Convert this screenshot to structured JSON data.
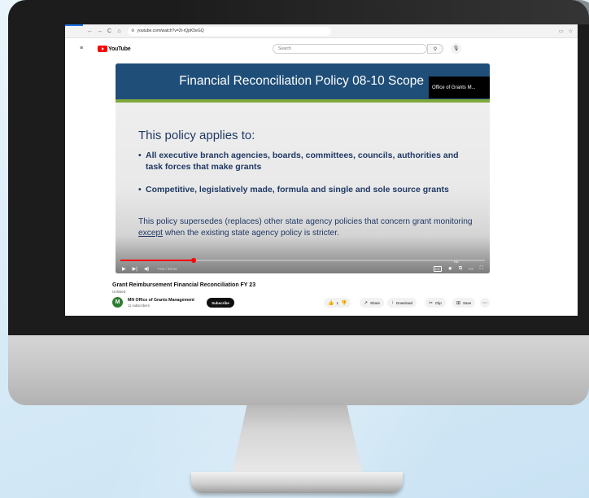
{
  "browser": {
    "url": "youtube.com/watch?v=2t-rQpK5eGQ",
    "back_icon": "←",
    "forward_icon": "→",
    "reload_icon": "C",
    "home_icon": "⌂",
    "site_info_icon": "⚙",
    "cast_icon": "▭",
    "star_icon": "☆"
  },
  "youtube": {
    "menu_icon": "≡",
    "logo_text": "YouTube",
    "search_placeholder": "Search",
    "search_icon": "⚲",
    "mic_icon": "🎙"
  },
  "video": {
    "slide_title": "Financial Reconciliation Policy 08-10 Scope",
    "channel_chip": "Office of Grants M...",
    "heading": "This policy applies to:",
    "bullets": [
      "All executive branch agencies, boards, committees, councils, authorities and task forces that make grants",
      "Competitive, legislatively made, formula and single and sole source grants"
    ],
    "bullet_mark": "•",
    "paragraph_before": "This policy supersedes (replaces) other state agency policies that concern grant monitoring ",
    "paragraph_underlined": "except",
    "paragraph_after": " when the existing state agency policy is stricter.",
    "progress_fraction": 0.2,
    "time": "7:54 / 40:04",
    "play_icon": "▶",
    "next_icon": "▶|",
    "volume_icon": "◀)",
    "cc_label": "CC",
    "settings_icon": "✸",
    "hd_badge": "HD",
    "miniplayer_icon": "⧉",
    "theater_icon": "▭",
    "fullscreen_icon": "⛶"
  },
  "below": {
    "title": "Grant Reimbursement Financial Reconciliation FY 23",
    "visibility": "Unlisted",
    "avatar_letter": "M",
    "channel_name": "MN Office of Grants Management",
    "subscribers": "11 subscribers",
    "subscribe_label": "Subscribe",
    "like_count": "1",
    "like_icon": "👍",
    "dislike_icon": "👎",
    "share_label": "Share",
    "share_icon": "↗",
    "download_label": "Download",
    "download_icon": "↓",
    "clip_label": "Clip",
    "clip_icon": "✂",
    "save_label": "Save",
    "save_icon": "⊞",
    "more_icon": "⋯"
  },
  "colors": {
    "slide_header": "#1f4e79",
    "slide_accent": "#7fa83a",
    "slide_text": "#1f3864",
    "progress": "#ff0000",
    "avatar": "#2e7d32"
  }
}
